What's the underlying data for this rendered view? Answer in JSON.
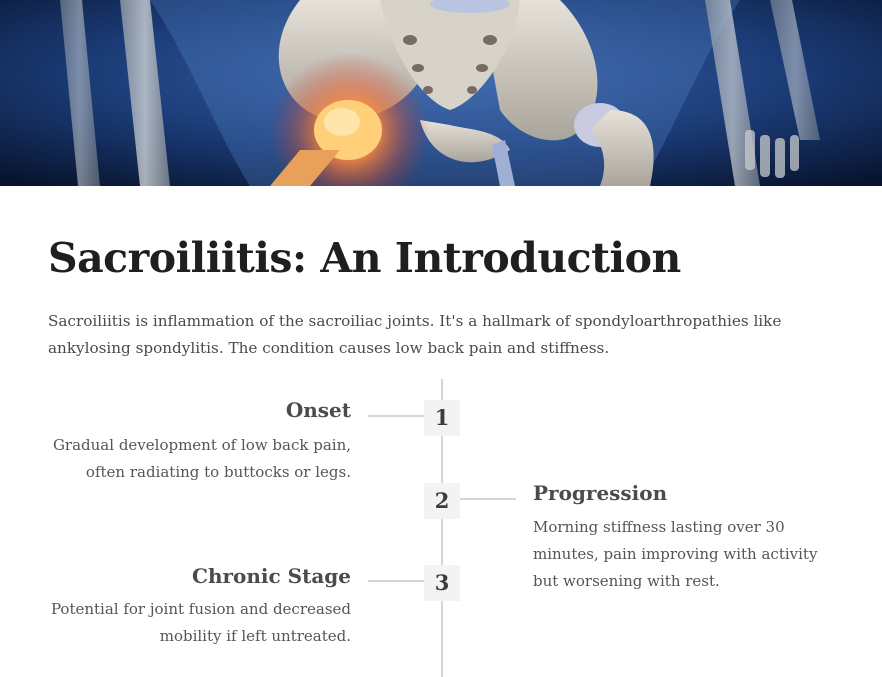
{
  "hero": {
    "image_icon": "pelvis-skeleton-xray-image"
  },
  "title": "Sacroiliitis: An Introduction",
  "intro": "Sacroiliitis is inflammation of the sacroiliac joints. It's a hallmark of spondyloarthropathies like ankylosing spondylitis. The condition causes low back pain and stiffness.",
  "timeline": {
    "steps": [
      {
        "number": "1",
        "title": "Onset",
        "description": "Gradual development of low back pain, often radiating to buttocks or legs."
      },
      {
        "number": "2",
        "title": "Progression",
        "description": "Morning stiffness lasting over 30 minutes, pain improving with activity but worsening with rest."
      },
      {
        "number": "3",
        "title": "Chronic Stage",
        "description": "Potential for joint fusion and decreased mobility if left untreated."
      }
    ]
  },
  "colors": {
    "hero_background": "#0c1f44",
    "inflammation_glow": "#ff7a2a",
    "timeline_line": "#d6d6d6",
    "step_badge": "#f3f3f3"
  }
}
